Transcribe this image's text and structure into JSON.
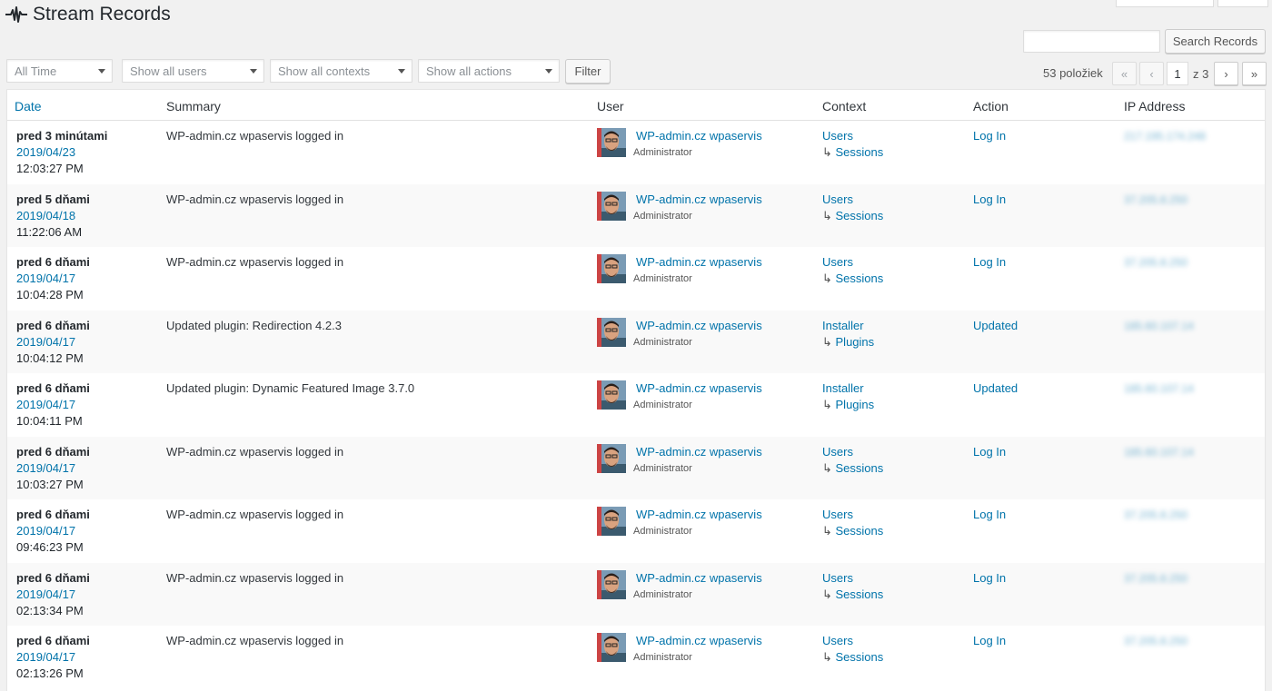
{
  "header": {
    "title": "Stream Records"
  },
  "search": {
    "placeholder": "",
    "button_label": "Search Records"
  },
  "filters": {
    "time": "All Time",
    "users": "Show all users",
    "contexts": "Show all contexts",
    "actions": "Show all actions",
    "filter_button": "Filter"
  },
  "pagination": {
    "items_count": "53 položiek",
    "first": "«",
    "prev": "‹",
    "current": "1",
    "of_total": "z 3",
    "next": "›",
    "last": "»"
  },
  "table": {
    "columns": {
      "date": "Date",
      "summary": "Summary",
      "user": "User",
      "context": "Context",
      "action": "Action",
      "ip": "IP Address"
    },
    "rows": [
      {
        "rel": "pred 3 minútami",
        "date": "2019/04/23",
        "time": "12:03:27 PM",
        "summary": "WP-admin.cz wpaservis logged in",
        "user": "WP-admin.cz wpaservis",
        "role": "Administrator",
        "context": "Users",
        "subcontext": "Sessions",
        "action": "Log In",
        "ip": "217.195.174.248"
      },
      {
        "rel": "pred 5 dňami",
        "date": "2019/04/18",
        "time": "11:22:06 AM",
        "summary": "WP-admin.cz wpaservis logged in",
        "user": "WP-admin.cz wpaservis",
        "role": "Administrator",
        "context": "Users",
        "subcontext": "Sessions",
        "action": "Log In",
        "ip": "37.205.8.250"
      },
      {
        "rel": "pred 6 dňami",
        "date": "2019/04/17",
        "time": "10:04:28 PM",
        "summary": "WP-admin.cz wpaservis logged in",
        "user": "WP-admin.cz wpaservis",
        "role": "Administrator",
        "context": "Users",
        "subcontext": "Sessions",
        "action": "Log In",
        "ip": "37.205.8.250"
      },
      {
        "rel": "pred 6 dňami",
        "date": "2019/04/17",
        "time": "10:04:12 PM",
        "summary": "Updated plugin: Redirection 4.2.3",
        "user": "WP-admin.cz wpaservis",
        "role": "Administrator",
        "context": "Installer",
        "subcontext": "Plugins",
        "action": "Updated",
        "ip": "185.60.107.14"
      },
      {
        "rel": "pred 6 dňami",
        "date": "2019/04/17",
        "time": "10:04:11 PM",
        "summary": "Updated plugin: Dynamic Featured Image 3.7.0",
        "user": "WP-admin.cz wpaservis",
        "role": "Administrator",
        "context": "Installer",
        "subcontext": "Plugins",
        "action": "Updated",
        "ip": "185.60.107.14"
      },
      {
        "rel": "pred 6 dňami",
        "date": "2019/04/17",
        "time": "10:03:27 PM",
        "summary": "WP-admin.cz wpaservis logged in",
        "user": "WP-admin.cz wpaservis",
        "role": "Administrator",
        "context": "Users",
        "subcontext": "Sessions",
        "action": "Log In",
        "ip": "185.60.107.14"
      },
      {
        "rel": "pred 6 dňami",
        "date": "2019/04/17",
        "time": "09:46:23 PM",
        "summary": "WP-admin.cz wpaservis logged in",
        "user": "WP-admin.cz wpaservis",
        "role": "Administrator",
        "context": "Users",
        "subcontext": "Sessions",
        "action": "Log In",
        "ip": "37.205.8.250"
      },
      {
        "rel": "pred 6 dňami",
        "date": "2019/04/17",
        "time": "02:13:34 PM",
        "summary": "WP-admin.cz wpaservis logged in",
        "user": "WP-admin.cz wpaservis",
        "role": "Administrator",
        "context": "Users",
        "subcontext": "Sessions",
        "action": "Log In",
        "ip": "37.205.8.250"
      },
      {
        "rel": "pred 6 dňami",
        "date": "2019/04/17",
        "time": "02:13:26 PM",
        "summary": "WP-admin.cz wpaservis logged in",
        "user": "WP-admin.cz wpaservis",
        "role": "Administrator",
        "context": "Users",
        "subcontext": "Sessions",
        "action": "Log In",
        "ip": "37.205.8.250"
      }
    ]
  },
  "colors": {
    "link": "#0073aa",
    "text": "#23282d",
    "background": "#f1f1f1"
  },
  "icons": {
    "stream": "stream-pulse-icon",
    "avatar": "user-avatar"
  }
}
